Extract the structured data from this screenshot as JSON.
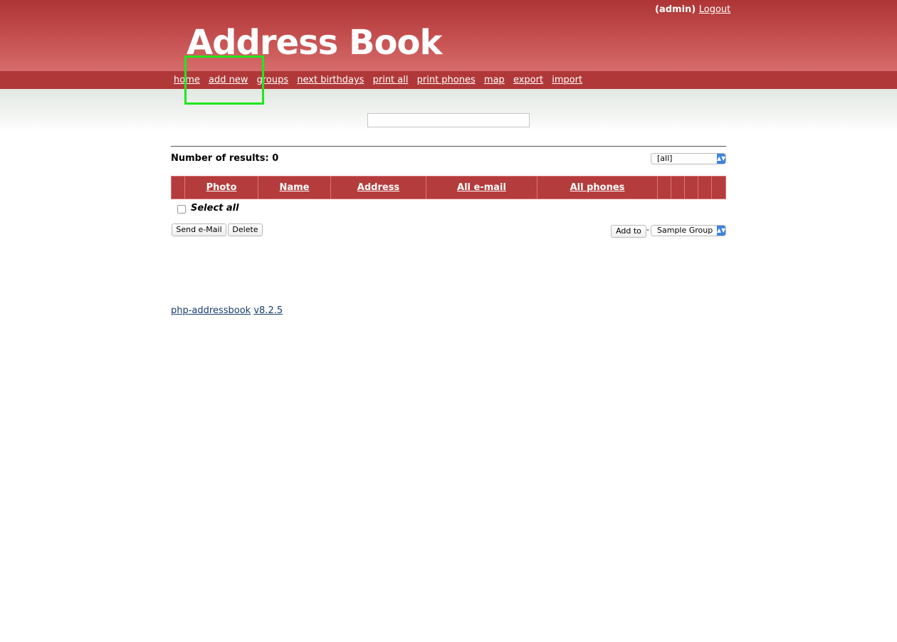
{
  "header": {
    "user": "(admin)",
    "logout": "Logout",
    "logo": "Address Book"
  },
  "nav": [
    {
      "name": "nav-home",
      "label": "home"
    },
    {
      "name": "nav-add-new",
      "label": "add new"
    },
    {
      "name": "nav-groups",
      "label": "groups"
    },
    {
      "name": "nav-next-birthdays",
      "label": "next birthdays"
    },
    {
      "name": "nav-print-all",
      "label": "print all"
    },
    {
      "name": "nav-print-phones",
      "label": "print phones"
    },
    {
      "name": "nav-map",
      "label": "map"
    },
    {
      "name": "nav-export",
      "label": "export"
    },
    {
      "name": "nav-import",
      "label": "import"
    }
  ],
  "search": {
    "value": ""
  },
  "results": {
    "label": "Number of results: 0",
    "group_filter": "[all]"
  },
  "table": {
    "headers": [
      "Photo",
      "Name",
      "Address",
      "All e-mail",
      "All phones"
    ]
  },
  "select_all": "Select all",
  "actions": {
    "send_email": "Send e-Mail",
    "delete": "Delete",
    "add_to": "Add to",
    "separator": "-",
    "target_group": "Sample Group"
  },
  "footer": {
    "app": "php-addressbook",
    "version": "v8.2.5"
  },
  "colors": {
    "header": "#ad3535",
    "nav": "#b03838",
    "table_header": "#b43c3c",
    "highlight": "#1ee81e"
  }
}
